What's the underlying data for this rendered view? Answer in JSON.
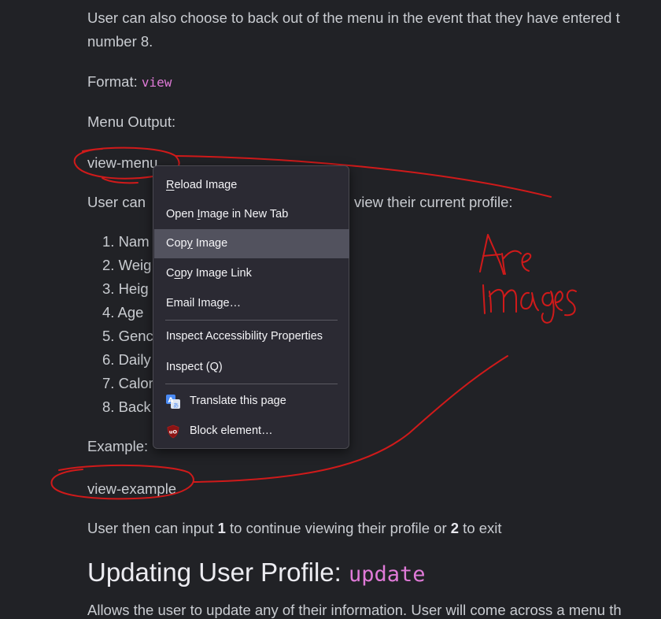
{
  "doc": {
    "intro_line1": "User can also choose to back out of the menu in the event that they have entered t",
    "intro_line2": "number 8.",
    "format_label": "Format: ",
    "format_code": "view",
    "menu_output_label": "Menu Output:",
    "image_alt_1": "view-menu",
    "select_prefix": "User can",
    "select_suffix": "view their current profile:",
    "list_items": [
      "1. Nam",
      "2. Weig",
      "3. Heig",
      "4. Age",
      "5. Genc",
      "6. Daily",
      "7. Calor",
      "8. Back"
    ],
    "example_label": "Example:",
    "image_alt_2": "view-example",
    "continue_pre": "User then can input ",
    "continue_b1": "1",
    "continue_mid": " to continue viewing their profile or ",
    "continue_b2": "2",
    "continue_post": " to exit",
    "heading_text": "Updating User Profile: ",
    "heading_code": "update",
    "bottom_line": "Allows the user to update any of their information. User will come across a menu th"
  },
  "context_menu": {
    "items": [
      {
        "label": "Reload Image",
        "accesskey": "R"
      },
      {
        "label": "Open Image in New Tab",
        "accesskey": "I"
      },
      {
        "label": "Copy Image",
        "accesskey": "y",
        "highlighted": true
      },
      {
        "label": "Copy Image Link",
        "accesskey": "o"
      },
      {
        "label": "Email Image…",
        "accesskey": "g"
      },
      {
        "label": "Inspect Accessibility Properties"
      },
      {
        "label": "Inspect (Q)"
      },
      {
        "label": "Translate this page",
        "icon": "translate-icon"
      },
      {
        "label": "Block element…",
        "icon": "ublock-origin-icon"
      }
    ]
  },
  "annotation": {
    "handwritten_note": "Are images",
    "ink_color": "#d01a1a"
  },
  "colors": {
    "background": "#212226",
    "text": "#c9ccd1",
    "code": "#e07ad8",
    "menu_bg": "#2b2a33",
    "menu_highlight": "#52525e"
  }
}
